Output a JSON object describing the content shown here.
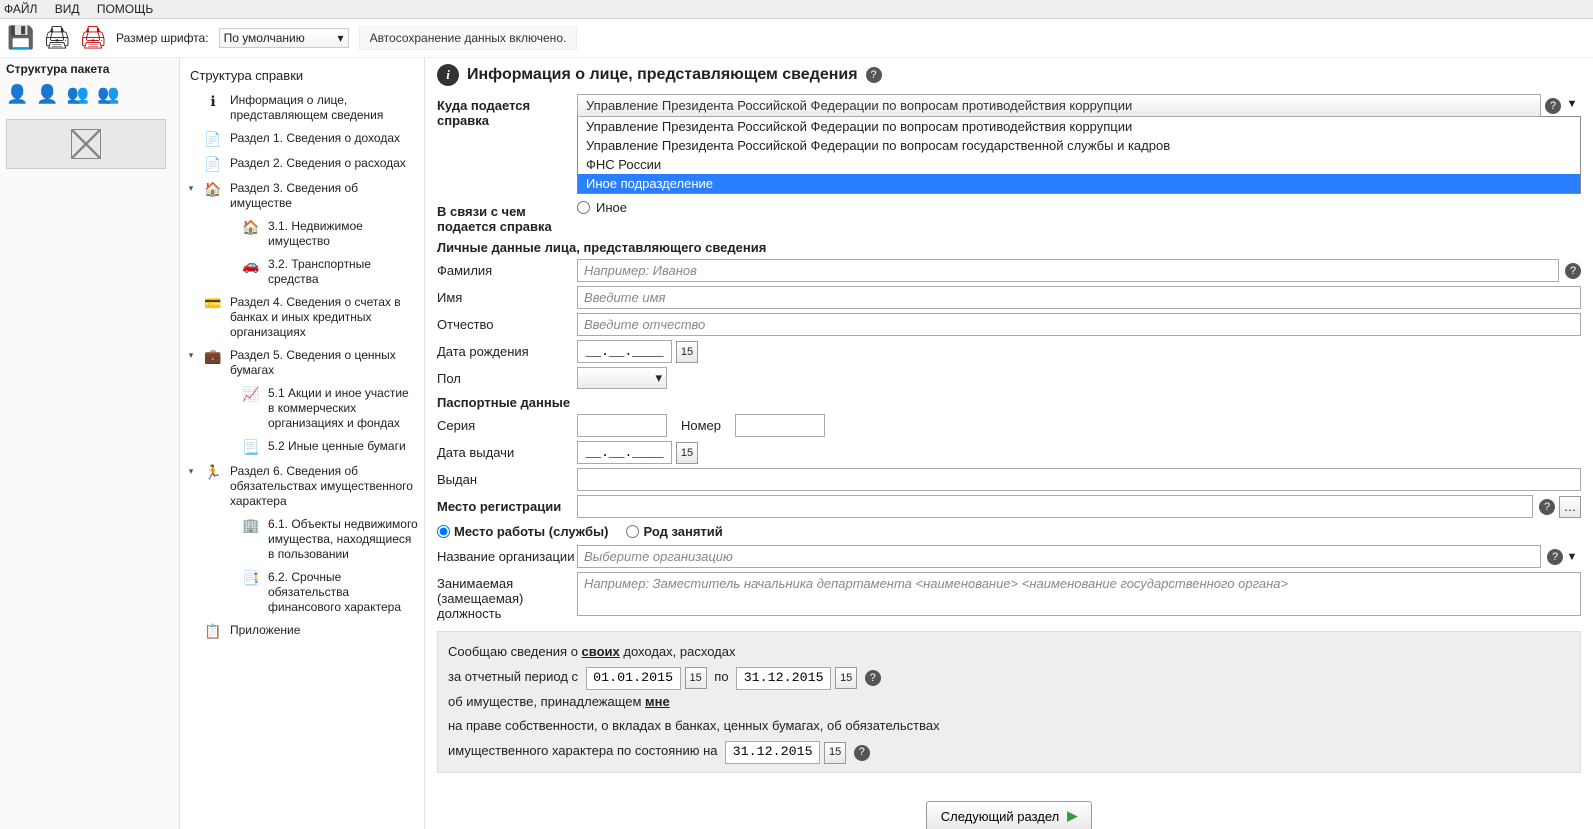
{
  "menu": {
    "file": "ФАЙЛ",
    "view": "ВИД",
    "help": "ПОМОЩЬ"
  },
  "toolbar": {
    "font_label": "Размер шрифта:",
    "font_value": "По умолчанию",
    "autosave": "Автосохранение данных включено."
  },
  "leftcol": {
    "title": "Структура пакета"
  },
  "midcol": {
    "title": "Структура справки",
    "items": [
      {
        "text": "Информация о лице, представляющем сведения",
        "icon": "ℹ"
      },
      {
        "text": "Раздел 1. Сведения о доходах",
        "icon": "📄"
      },
      {
        "text": "Раздел 2. Сведения о расходах",
        "icon": "📄"
      },
      {
        "text": "Раздел 3. Сведения об имуществе",
        "icon": "🏠",
        "expand": "▾"
      },
      {
        "text": "3.1. Недвижимое имущество",
        "icon": "🏠",
        "sub": true
      },
      {
        "text": "3.2. Транспортные средства",
        "icon": "🚗",
        "sub": true
      },
      {
        "text": "Раздел 4. Сведения о счетах в банках и иных кредитных организациях",
        "icon": "💳"
      },
      {
        "text": "Раздел 5. Сведения о ценных бумагах",
        "icon": "💼",
        "expand": "▾"
      },
      {
        "text": "5.1 Акции и иное участие в коммерческих организациях и фондах",
        "icon": "📈",
        "sub": true
      },
      {
        "text": "5.2 Иные ценные бумаги",
        "icon": "📃",
        "sub": true
      },
      {
        "text": "Раздел 6. Сведения об обязательствах имущественного характера",
        "icon": "🏃",
        "expand": "▾"
      },
      {
        "text": "6.1. Объекты недвижимого имущества, находящиеся в пользовании",
        "icon": "🏢",
        "sub": true
      },
      {
        "text": "6.2. Срочные обязательства финансового характера",
        "icon": "📑",
        "sub": true
      },
      {
        "text": "Приложение",
        "icon": "📋"
      }
    ]
  },
  "main": {
    "title": "Информация о лице, представляющем сведения",
    "dest_label": "Куда подается справка",
    "dest_value": "Управление Президента Российской Федерации по вопросам противодействия коррупции",
    "dest_options": [
      "Управление Президента Российской Федерации по вопросам противодействия коррупции",
      "Управление Президента Российской Федерации по вопросам государственной службы и кадров",
      "ФНС России",
      "Иное подразделение"
    ],
    "reason_label": "В связи с чем подается справка",
    "reason_other": "Иное",
    "personal_head": "Личные данные лица, представляющего сведения",
    "surname_label": "Фамилия",
    "surname_ph": "Например: Иванов",
    "name_label": "Имя",
    "name_ph": "Введите имя",
    "patronymic_label": "Отчество",
    "patronymic_ph": "Введите отчество",
    "dob_label": "Дата рождения",
    "dob_mask": "__.__.____",
    "gender_label": "Пол",
    "passport_head": "Паспортные данные",
    "series_label": "Серия",
    "number_label": "Номер",
    "issue_date_label": "Дата выдачи",
    "issued_by_label": "Выдан",
    "reg_label": "Место регистрации",
    "work_radio": "Место работы (службы)",
    "occ_radio": "Род занятий",
    "org_label": "Название организации",
    "org_ph": "Выберите организацию",
    "pos_label": "Занимаемая (замещаемая) должность",
    "pos_ph": "Например: Заместитель начальника департамента <наименование> <наименование государственного органа>",
    "summary": {
      "l1a": "Сообщаю сведения о ",
      "l1b": "своих",
      "l1c": " доходах, расходах",
      "l2a": "за отчетный период с",
      "period_from": "01.01.2015",
      "l2b": "по",
      "period_to": "31.12.2015",
      "l3a": "об имуществе, принадлежащем ",
      "l3b": "мне",
      "l4": "на праве собственности, о вкладах в банках, ценных бумагах, об обязательствах",
      "l5a": "имущественного характера по состоянию на",
      "asof": "31.12.2015"
    },
    "next": "Следующий раздел"
  }
}
